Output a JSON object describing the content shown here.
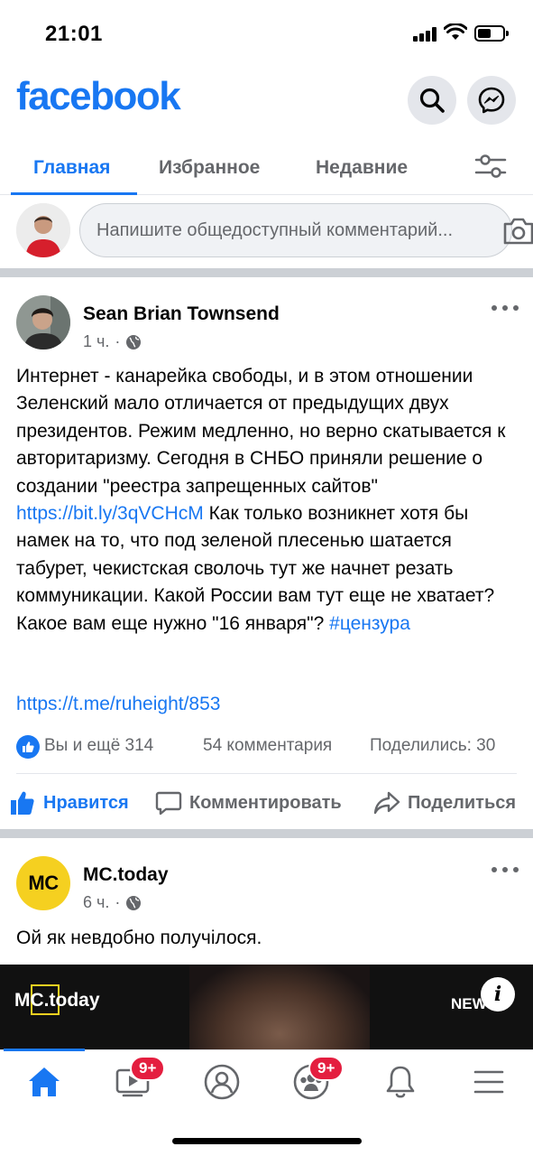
{
  "status": {
    "time": "21:01"
  },
  "header": {
    "logo": "facebook",
    "icons": [
      "search-icon",
      "messenger-icon"
    ]
  },
  "tabs": [
    {
      "label": "Главная",
      "active": true
    },
    {
      "label": "Избранное",
      "active": false
    },
    {
      "label": "Недавние",
      "active": false
    }
  ],
  "composer": {
    "placeholder": "Напишите общедоступный комментарий..."
  },
  "post1": {
    "author": "Sean Brian Townsend",
    "time": "1 ч.",
    "dot": "·",
    "text_before_link": "Интернет - канарейка свободы, и в этом отношении Зеленский мало отличается от предыдущих двух президентов. Режим медленно, но верно скатывается к авторитаризму. Сегодня в СНБО приняли решение о создании \"реестра запрещенных сайтов\" ",
    "link1": "https://bit.ly/3qVCHcM",
    "text_after_link": " Как только возникнет хотя бы намек на то, что под зеленой плесенью шатается табурет, чекистская сволочь тут же начнет резать коммуникации. Какой России вам тут еще не хватает? Какое вам еще нужно \"16 января\"? ",
    "hashtag": "#цензура",
    "link2": "https://t.me/ruheight/853",
    "reactions": "Вы и ещё 314",
    "comments": "54 комментария",
    "shares": "Поделились: 30"
  },
  "actions": {
    "like": "Нравится",
    "comment": "Комментировать",
    "share": "Поделиться"
  },
  "post2": {
    "author": "MC.today",
    "time": "6 ч.",
    "dot": "·",
    "text": "Ой як невдобно получілося.",
    "avatar_text": "MC",
    "video_watermark": "MC.today",
    "video_corner_text": "NEW"
  },
  "bottom_nav": {
    "video_badge": "9+",
    "groups_badge": "9+"
  },
  "colors": {
    "brand": "#1877f2",
    "badge": "#e41e3f",
    "mc_yellow": "#f5d020"
  }
}
